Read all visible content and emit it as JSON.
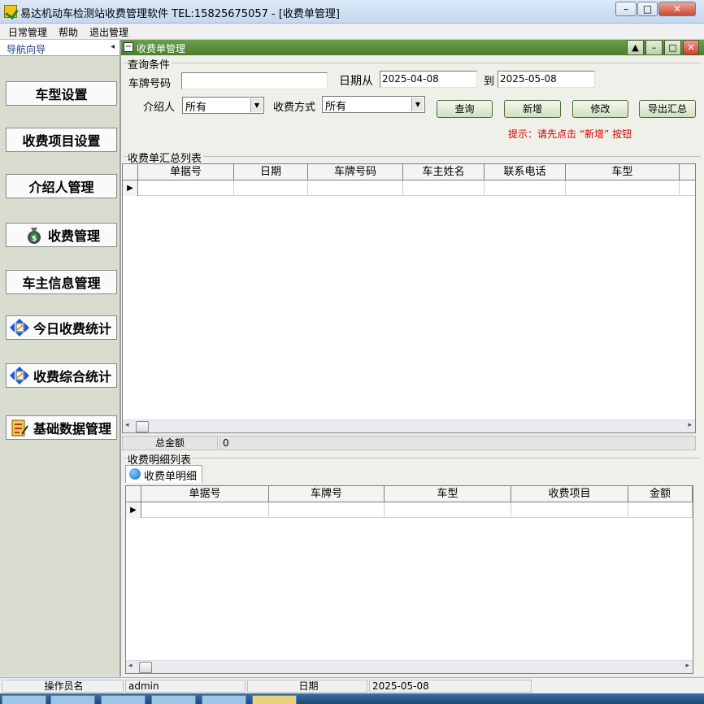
{
  "window": {
    "title": "易达机动车检测站收费管理软件  TEL:15825675057    - [收费单管理]",
    "minimize": "–",
    "maximize": "□",
    "close": "✕"
  },
  "menu": [
    "日常管理",
    "帮助",
    "退出管理"
  ],
  "nav": {
    "header": "导航向导",
    "collapse": "◂",
    "items": [
      {
        "label": "车型设置",
        "icon": ""
      },
      {
        "label": "收费项目设置",
        "icon": ""
      },
      {
        "label": "介绍人管理",
        "icon": ""
      },
      {
        "label": "收费管理",
        "icon": "money-bag-icon"
      },
      {
        "label": "车主信息管理",
        "icon": ""
      },
      {
        "label": "今日收费统计",
        "icon": "stats-chart-icon"
      },
      {
        "label": "收费综合统计",
        "icon": "stats-chart-icon"
      },
      {
        "label": "基础数据管理",
        "icon": "data-form-icon"
      }
    ]
  },
  "child": {
    "title": "收费单管理",
    "query": {
      "group_label": "查询条件",
      "plate_label": "车牌号码",
      "plate_value": "",
      "date_from_label": "日期从",
      "date_from": "2025-04-08",
      "date_to_label": "到",
      "date_to": "2025-05-08",
      "referrer_label": "介绍人",
      "referrer_value": "所有",
      "pay_method_label": "收费方式",
      "pay_method_value": "所有",
      "btn_query": "查询",
      "btn_new": "新增",
      "btn_edit": "修改",
      "btn_export": "导出汇总",
      "hint": "提示：请先点击 “新增” 按钮"
    },
    "summary": {
      "group_label": "收费单汇总列表",
      "columns": [
        "单据号",
        "日期",
        "车牌号码",
        "车主姓名",
        "联系电话",
        "车型"
      ],
      "total_label": "总金额",
      "total_value": "0"
    },
    "detail": {
      "group_label": "收费明细列表",
      "tab_label": "收费单明细",
      "columns": [
        "单据号",
        "车牌号",
        "车型",
        "收费项目",
        "金额"
      ]
    }
  },
  "status": {
    "operator_label": "操作员名",
    "operator_value": "admin",
    "date_label": "日期",
    "date_value": "2025-05-08"
  }
}
